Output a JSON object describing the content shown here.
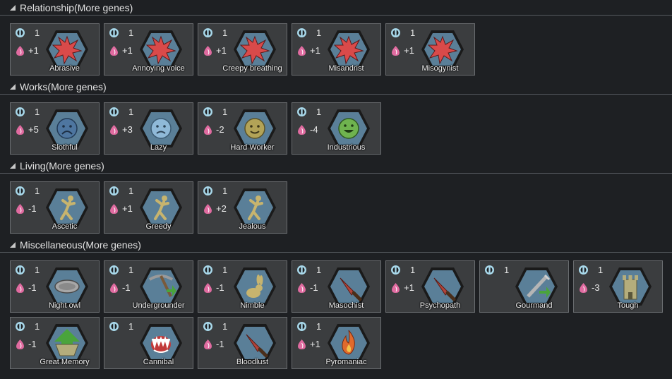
{
  "sections": [
    {
      "title": "Relationship(More genes)",
      "genes": [
        {
          "cx": "1",
          "met": "+1",
          "name": "Abrasive",
          "icon": "burst-icon"
        },
        {
          "cx": "1",
          "met": "+1",
          "name": "Annoying voice",
          "icon": "burst-icon"
        },
        {
          "cx": "1",
          "met": "+1",
          "name": "Creepy breathing",
          "icon": "burst-icon"
        },
        {
          "cx": "1",
          "met": "+1",
          "name": "Misandrist",
          "icon": "burst-icon"
        },
        {
          "cx": "1",
          "met": "+1",
          "name": "Misogynist",
          "icon": "burst-icon"
        }
      ]
    },
    {
      "title": "Works(More genes)",
      "genes": [
        {
          "cx": "1",
          "met": "+5",
          "name": "Slothful",
          "icon": "very-sad-face-icon"
        },
        {
          "cx": "1",
          "met": "+3",
          "name": "Lazy",
          "icon": "sad-face-icon"
        },
        {
          "cx": "1",
          "met": "-2",
          "name": "Hard Worker",
          "icon": "smile-face-icon"
        },
        {
          "cx": "1",
          "met": "-4",
          "name": "Industrious",
          "icon": "grin-face-icon"
        }
      ]
    },
    {
      "title": "Living(More genes)",
      "genes": [
        {
          "cx": "1",
          "met": "-1",
          "name": "Ascetic",
          "icon": "figure-icon"
        },
        {
          "cx": "1",
          "met": "+1",
          "name": "Greedy",
          "icon": "figure-icon"
        },
        {
          "cx": "1",
          "met": "+2",
          "name": "Jealous",
          "icon": "figure-icon"
        }
      ]
    },
    {
      "title": "Miscellaneous(More genes)",
      "genes": [
        {
          "cx": "1",
          "met": "-1",
          "name": "Night owl",
          "icon": "eye-icon"
        },
        {
          "cx": "1",
          "met": "-1",
          "name": "Undergrounder",
          "icon": "pickaxe-icon"
        },
        {
          "cx": "1",
          "met": "-1",
          "name": "Nimble",
          "icon": "rabbit-icon"
        },
        {
          "cx": "1",
          "met": "-1",
          "name": "Masochist",
          "icon": "knife-icon"
        },
        {
          "cx": "1",
          "met": "+1",
          "name": "Psychopath",
          "icon": "knife-icon"
        },
        {
          "cx": "1",
          "met": "",
          "name": "Gourmand",
          "icon": "pickaxe-plain-icon"
        },
        {
          "cx": "1",
          "met": "-3",
          "name": "Tough",
          "icon": "tower-icon"
        },
        {
          "cx": "1",
          "met": "-1",
          "name": "Great Memory",
          "icon": "arrow-up-icon"
        },
        {
          "cx": "1",
          "met": "",
          "name": "Cannibal",
          "icon": "fangs-icon"
        },
        {
          "cx": "1",
          "met": "-1",
          "name": "Bloodlust",
          "icon": "knife-icon"
        },
        {
          "cx": "1",
          "met": "+1",
          "name": "Pyromaniac",
          "icon": "flame-icon"
        }
      ]
    }
  ],
  "colors": {
    "background": "#1e2023",
    "card": "#3b3d3f",
    "hex_fill": "#5a7f98",
    "hex_border": "#1a1a1a",
    "complexity": "#a8d8ea",
    "metabolism": "#e06ba0",
    "burst": "#d94a4a",
    "figure": "#c7b46e"
  }
}
